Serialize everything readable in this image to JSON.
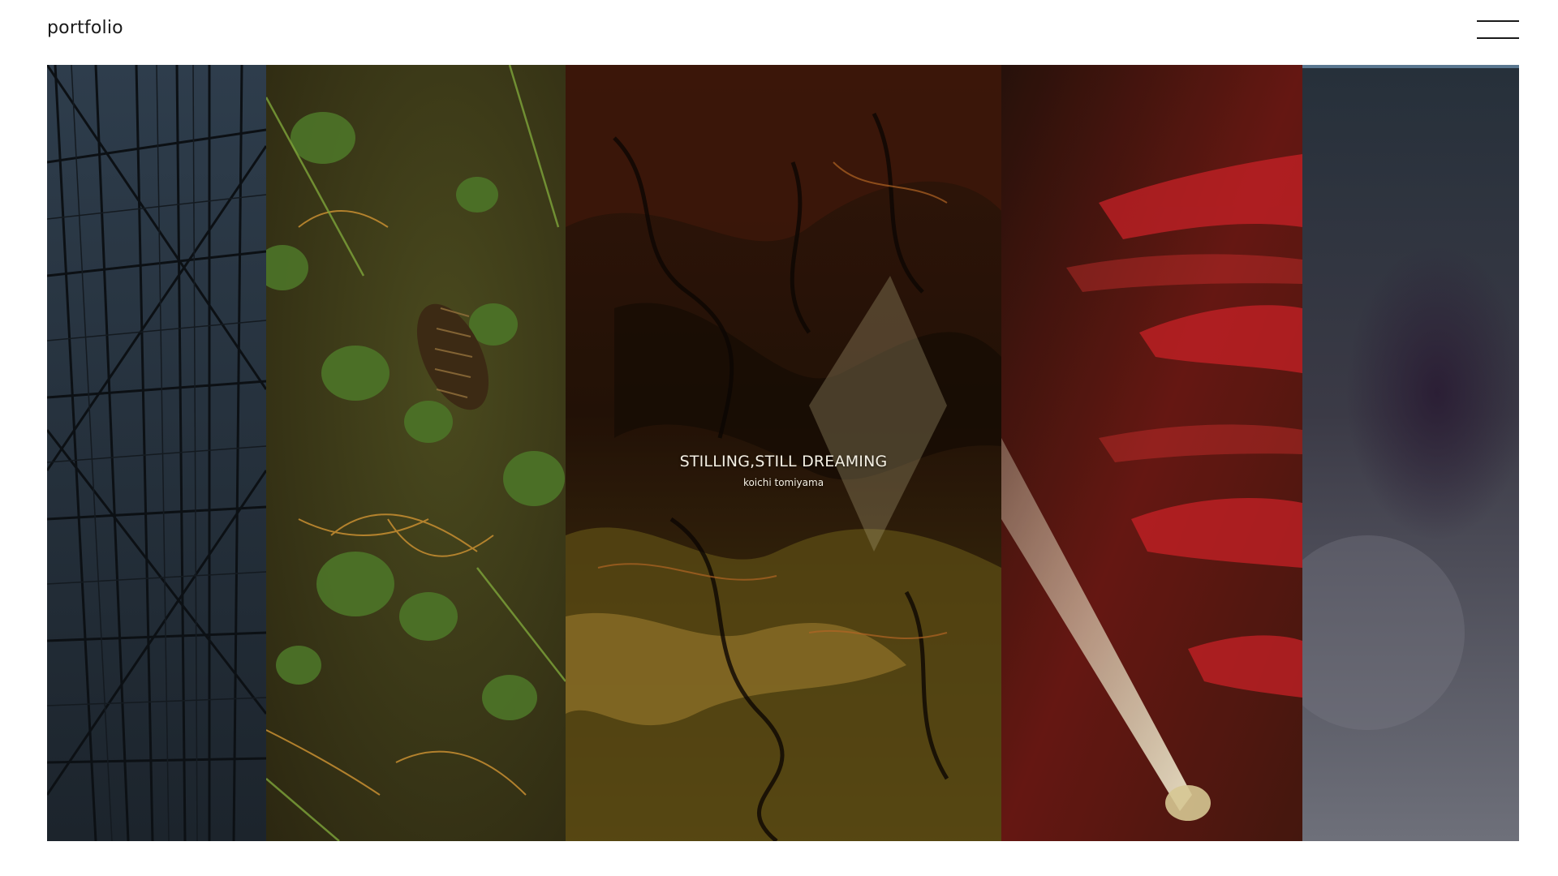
{
  "header": {
    "logo": "portfolio",
    "menu_icon": "hamburger-menu-icon"
  },
  "gallery": {
    "panels": [
      {
        "subject": "steel-lattice-tower",
        "colors": {
          "base": "#2b3946",
          "line": "#0d1216"
        }
      },
      {
        "subject": "forest-floor-pinecone-leaves",
        "colors": {
          "base": "#3c3a16",
          "leaf": "#4f7a2a",
          "straw": "#b4822e"
        }
      },
      {
        "subject": "marbled-fluid-abstract",
        "colors": {
          "base": "#3a1a0a",
          "light": "#c9a93e",
          "dark": "#120804"
        }
      },
      {
        "subject": "red-light-beam",
        "colors": {
          "base": "#7a1c16",
          "red": "#d8262a",
          "beam": "#f2edc4"
        }
      },
      {
        "subject": "grey-purple-haze",
        "colors": {
          "base": "#3a3e47",
          "purple": "#2b1f33",
          "grey": "#6d6f79"
        }
      }
    ],
    "featured": {
      "title": "STILLING,STILL DREAMING",
      "author": "koichi tomiyama"
    }
  }
}
